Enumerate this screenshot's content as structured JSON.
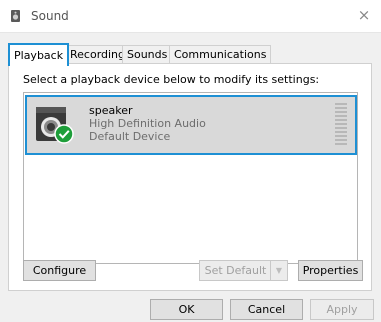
{
  "window": {
    "title": "Sound",
    "icon": "speaker-window-icon",
    "close_glyph": "×"
  },
  "tabs": [
    {
      "label": "Playback",
      "active": true
    },
    {
      "label": "Recording",
      "active": false
    },
    {
      "label": "Sounds",
      "active": false
    },
    {
      "label": "Communications",
      "active": false
    }
  ],
  "playback": {
    "instruction": "Select a playback device below to modify its settings:",
    "devices": [
      {
        "name": "speaker",
        "driver": "High Definition Audio",
        "status": "Default Device",
        "icon": "speaker-device-icon",
        "badge": "default-check-icon",
        "selected": true,
        "level": 0
      }
    ]
  },
  "panel_buttons": {
    "configure": "Configure",
    "set_default": "Set Default",
    "set_default_arrow": "▼",
    "properties": "Properties"
  },
  "dialog_buttons": {
    "ok": "OK",
    "cancel": "Cancel",
    "apply": "Apply"
  },
  "colors": {
    "accent": "#1e90d4",
    "check_green": "#1e9e3a",
    "selection_bg": "#d9d9d9"
  }
}
